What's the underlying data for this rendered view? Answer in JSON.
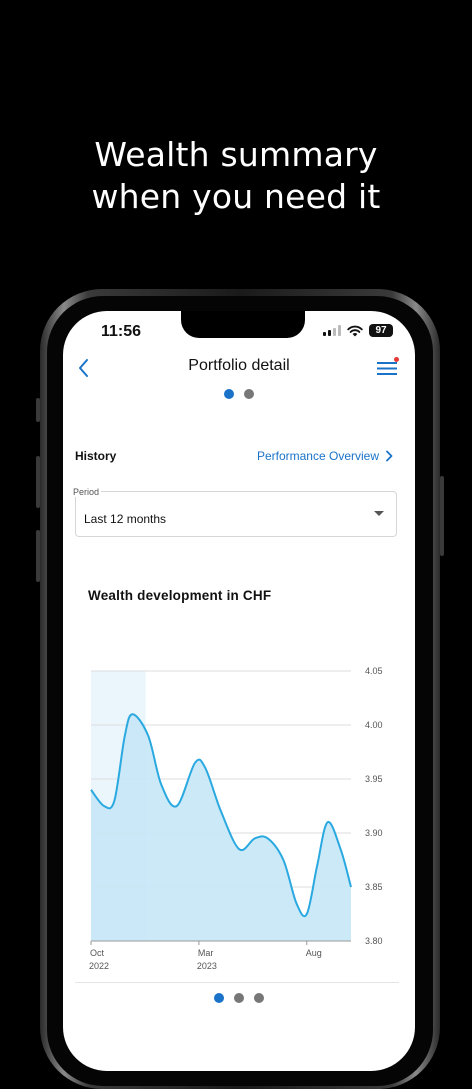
{
  "marketing": {
    "headline_line1": "Wealth summary",
    "headline_line2": "when you need it"
  },
  "status_bar": {
    "time": "11:56",
    "battery": "97"
  },
  "nav": {
    "title": "Portfolio detail",
    "back_icon": "chevron-left-icon",
    "menu_icon": "hamburger-menu-icon",
    "has_notification": true
  },
  "page_indicator": {
    "count": 2,
    "active": 0
  },
  "history": {
    "label": "History",
    "link_label": "Performance Overview"
  },
  "period": {
    "label": "Period",
    "value": "Last 12 months"
  },
  "chart_title": "Wealth development in CHF",
  "colors": {
    "accent": "#1a73c8",
    "line": "#2aa9e0",
    "fill": "#c7e7f7",
    "highlight": "#eaf6fc"
  },
  "chart_data": {
    "type": "area",
    "title": "Wealth development in CHF",
    "ylim": [
      3.8,
      4.05
    ],
    "y_ticks": [
      "4.05",
      "4.00",
      "3.95",
      "3.90",
      "3.85",
      "3.80"
    ],
    "x_ticks": [
      {
        "line1": "Oct",
        "line2": "2022",
        "t": 0.0
      },
      {
        "line1": "Mar",
        "line2": "2023",
        "t": 0.415
      },
      {
        "line1": "Aug",
        "line2": "",
        "t": 0.83
      }
    ],
    "highlight_range": [
      0.0,
      0.21
    ],
    "series": [
      {
        "points": [
          [
            0.0,
            3.94
          ],
          [
            0.05,
            3.925
          ],
          [
            0.09,
            3.93
          ],
          [
            0.13,
            3.99
          ],
          [
            0.16,
            4.01
          ],
          [
            0.22,
            3.99
          ],
          [
            0.27,
            3.945
          ],
          [
            0.33,
            3.925
          ],
          [
            0.4,
            3.965
          ],
          [
            0.44,
            3.96
          ],
          [
            0.5,
            3.92
          ],
          [
            0.57,
            3.885
          ],
          [
            0.63,
            3.895
          ],
          [
            0.68,
            3.895
          ],
          [
            0.74,
            3.875
          ],
          [
            0.79,
            3.835
          ],
          [
            0.83,
            3.825
          ],
          [
            0.87,
            3.87
          ],
          [
            0.91,
            3.91
          ],
          [
            0.96,
            3.885
          ],
          [
            1.0,
            3.85
          ]
        ]
      }
    ],
    "grid": true
  },
  "bottom_indicator": {
    "count": 3,
    "active": 0
  }
}
